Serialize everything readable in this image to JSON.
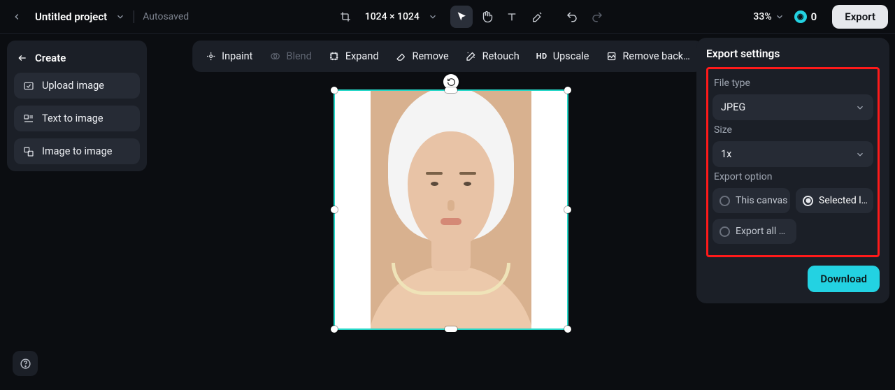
{
  "header": {
    "project_title": "Untitled project",
    "autosaved_label": "Autosaved",
    "dimensions_label": "1024 × 1024",
    "zoom_label": "33%",
    "credits_value": "0",
    "export_label": "Export"
  },
  "sidebar": {
    "create_label": "Create",
    "items": [
      {
        "label": "Upload image"
      },
      {
        "label": "Text to image"
      },
      {
        "label": "Image to image"
      }
    ]
  },
  "actionbar": {
    "inpaint": "Inpaint",
    "blend": "Blend",
    "expand": "Expand",
    "remove": "Remove",
    "retouch": "Retouch",
    "upscale_prefix": "HD",
    "upscale": "Upscale",
    "remove_bg": "Remove back…"
  },
  "export_panel": {
    "title": "Export settings",
    "file_type_label": "File type",
    "file_type_value": "JPEG",
    "size_label": "Size",
    "size_value": "1x",
    "export_option_label": "Export option",
    "opt_this_canvas": "This canvas",
    "opt_selected": "Selected l…",
    "opt_export_all": "Export all …",
    "download_label": "Download"
  }
}
